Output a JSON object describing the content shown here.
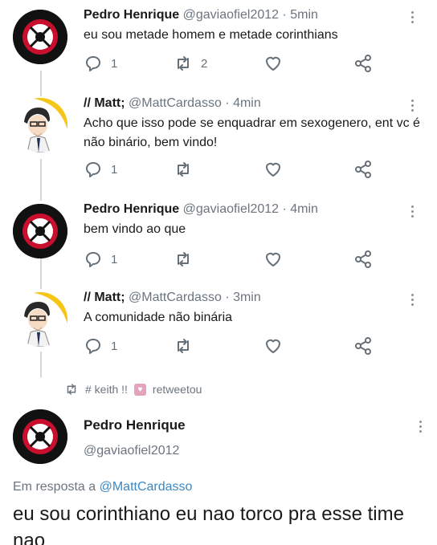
{
  "thread": [
    {
      "avatar": "corinthians-avatar",
      "display_name": "Pedro Henrique",
      "handle": "@gaviaofiel2012",
      "separator": "·",
      "time": "5min",
      "text": "eu sou metade homem e metade corinthians",
      "replies": "1",
      "retweets": "2",
      "likes": ""
    },
    {
      "avatar": "matt-avatar",
      "display_name": "// Matt;",
      "handle": "@MattCardasso",
      "separator": "·",
      "time": "4min",
      "text": "Acho que isso pode se enquadrar em sexogenero, ent vc é não binário, bem vindo!",
      "replies": "1",
      "retweets": "",
      "likes": ""
    },
    {
      "avatar": "corinthians-avatar",
      "display_name": "Pedro Henrique",
      "handle": "@gaviaofiel2012",
      "separator": "·",
      "time": "4min",
      "text": "bem vindo ao que",
      "replies": "1",
      "retweets": "",
      "likes": ""
    },
    {
      "avatar": "matt-avatar",
      "display_name": "// Matt;",
      "handle": "@MattCardasso",
      "separator": "·",
      "time": "3min",
      "text": "A comunidade não binária",
      "replies": "1",
      "retweets": "",
      "likes": ""
    }
  ],
  "retweet_banner": {
    "user": "# keith !!",
    "action": "retweetou"
  },
  "main_tweet": {
    "display_name": "Pedro Henrique",
    "handle": "@gaviaofiel2012",
    "reply_prefix": "Em resposta a",
    "reply_to": "@MattCardasso",
    "text": "eu sou corinthiano eu nao torco pra esse time nao"
  },
  "colors": {
    "secondary_text": "#6b7580",
    "mention": "#3b88c3",
    "thread_line": "#cfd9de",
    "retweet_badge": "#e3a3bd"
  }
}
